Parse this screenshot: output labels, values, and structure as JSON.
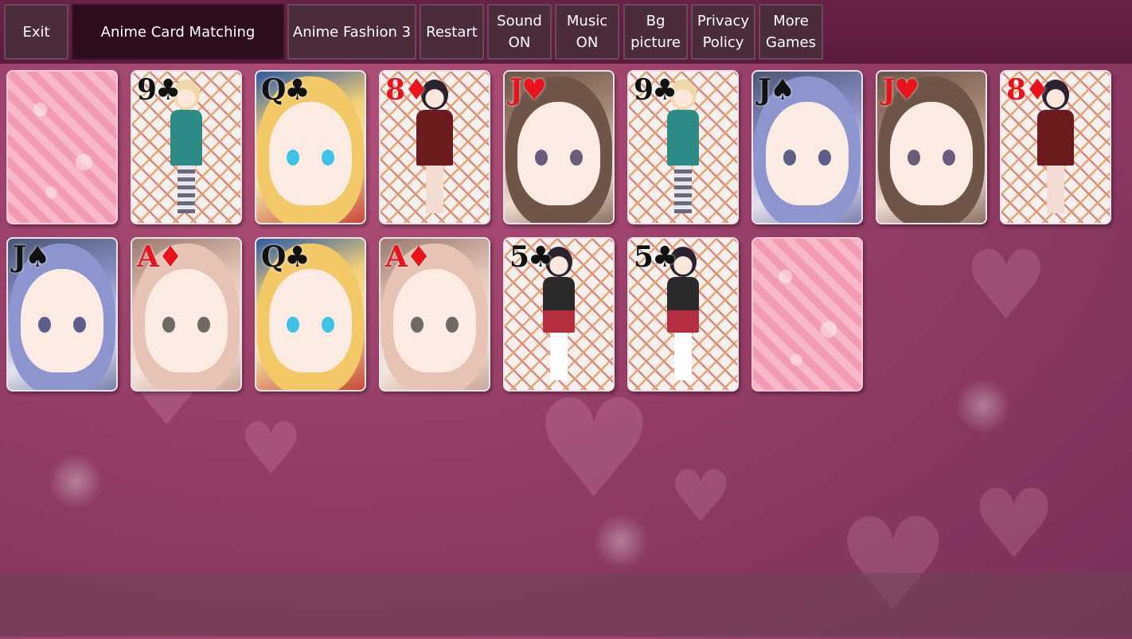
{
  "topbar": {
    "buttons": [
      {
        "id": "exit",
        "label": "Exit"
      },
      {
        "id": "title",
        "label": "Anime Card Matching"
      },
      {
        "id": "fashion",
        "label": "Anime Fashion 3"
      },
      {
        "id": "restart",
        "label": "Restart"
      },
      {
        "id": "sound",
        "label": "Sound\nON"
      },
      {
        "id": "music",
        "label": "Music\nON"
      },
      {
        "id": "bg",
        "label": "Bg\npicture"
      },
      {
        "id": "privacy",
        "label": "Privacy\nPolicy"
      },
      {
        "id": "more",
        "label": "More\nGames"
      }
    ]
  },
  "cards": [
    {
      "state": "back",
      "rank": "",
      "suit": "",
      "color": "",
      "art": "back"
    },
    {
      "state": "face",
      "rank": "9",
      "suit": "♣",
      "color": "black",
      "art": "full-body-blonde-green-coat"
    },
    {
      "state": "face",
      "rank": "Q",
      "suit": "♣",
      "color": "black",
      "art": "portrait-blonde"
    },
    {
      "state": "face",
      "rank": "8",
      "suit": "♦",
      "color": "red",
      "art": "full-body-dark-hair-red-dress"
    },
    {
      "state": "face",
      "rank": "J",
      "suit": "♥",
      "color": "red",
      "art": "portrait-brown"
    },
    {
      "state": "face",
      "rank": "9",
      "suit": "♣",
      "color": "black",
      "art": "full-body-blonde-green-coat"
    },
    {
      "state": "face",
      "rank": "J",
      "suit": "♠",
      "color": "black",
      "art": "portrait-blue"
    },
    {
      "state": "face",
      "rank": "J",
      "suit": "♥",
      "color": "red",
      "art": "portrait-brown"
    },
    {
      "state": "face",
      "rank": "8",
      "suit": "♦",
      "color": "red",
      "art": "full-body-dark-hair-red-dress"
    },
    {
      "state": "face",
      "rank": "J",
      "suit": "♠",
      "color": "black",
      "art": "portrait-blue"
    },
    {
      "state": "face",
      "rank": "A",
      "suit": "♦",
      "color": "red",
      "art": "portrait-pink"
    },
    {
      "state": "face",
      "rank": "Q",
      "suit": "♣",
      "color": "black",
      "art": "portrait-blonde"
    },
    {
      "state": "face",
      "rank": "A",
      "suit": "♦",
      "color": "red",
      "art": "portrait-pink"
    },
    {
      "state": "face",
      "rank": "5",
      "suit": "♣",
      "color": "black",
      "art": "full-body-dark-hair-school-uniform"
    },
    {
      "state": "face",
      "rank": "5",
      "suit": "♣",
      "color": "black",
      "art": "full-body-dark-hair-school-uniform"
    },
    {
      "state": "back",
      "rank": "",
      "suit": "",
      "color": "",
      "art": "back"
    }
  ],
  "colors": {
    "background": "#943d67",
    "topbar": "#5a1b3d",
    "button": "#4b2c3a",
    "title_button": "#2b0d1c",
    "suit_red": "#e8131b",
    "suit_black": "#111111",
    "card_back": "#f39bb2"
  }
}
